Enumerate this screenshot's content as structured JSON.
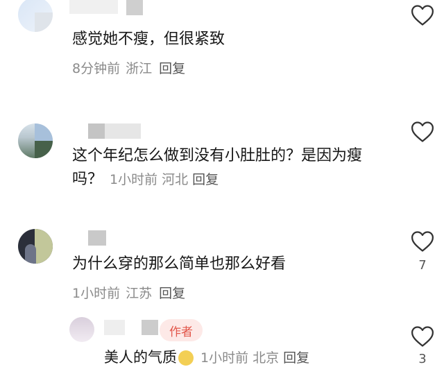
{
  "comments": [
    {
      "text": "感觉她不瘦，但很紧致",
      "time": "8分钟前",
      "location": "浙江",
      "reply": "回复"
    },
    {
      "text": "这个年纪怎么做到没有小肚肚的？是因为瘦吗？",
      "time": "1小时前",
      "location": "河北",
      "reply": "回复"
    },
    {
      "text": "为什么穿的那么简单也那么好看",
      "time": "1小时前",
      "location": "江苏",
      "reply": "回复",
      "like_count": "7"
    },
    {
      "badge": "作者",
      "text": "美人的气质",
      "time": "1小时前",
      "location": "北京",
      "reply": "回复",
      "like_count": "3"
    }
  ],
  "icons": {
    "like": "heart-outline-icon",
    "emoji": "emoji-face-icon"
  },
  "colors": {
    "text": "#161616",
    "meta": "#8a8a8a",
    "author_badge_bg": "#fde9e7",
    "author_badge_text": "#e2564a"
  }
}
